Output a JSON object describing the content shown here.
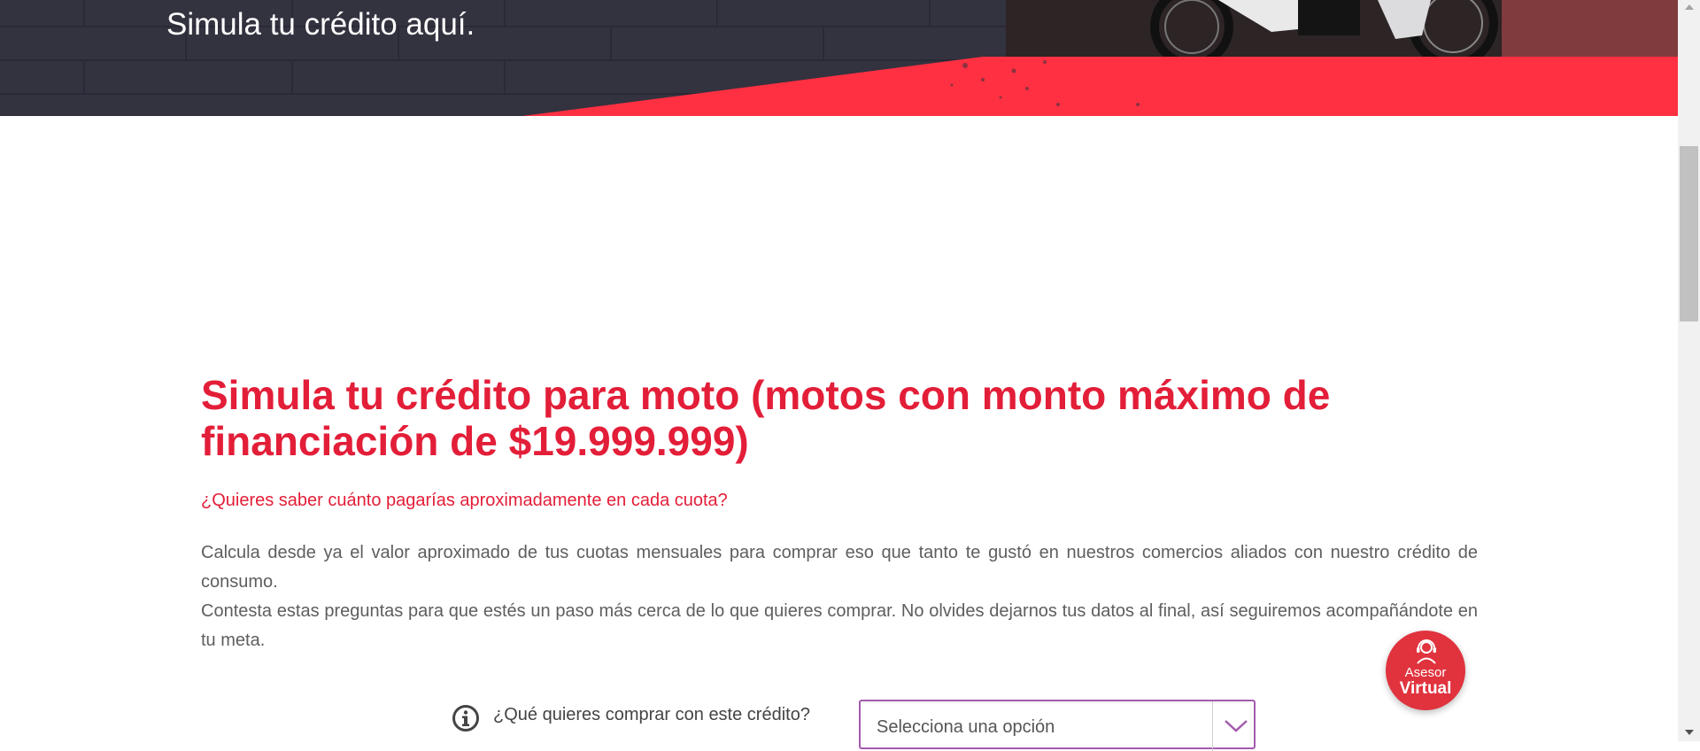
{
  "hero": {
    "title": "Simula tu crédito aquí."
  },
  "main": {
    "title": "Simula tu crédito para moto (motos con monto máximo de financiación de $19.999.999)",
    "subtitle": "¿Quieres saber cuánto pagarías aproximadamente en cada cuota?",
    "paragraph1": "Calcula desde ya el valor aproximado de tus cuotas mensuales para comprar eso que tanto te gustó en nuestros comercios aliados con nuestro crédito de consumo.",
    "paragraph2": "Contesta estas preguntas para que estés un paso más cerca de lo que quieres comprar. No olvides dejarnos tus datos al final, así seguiremos acompañándote en tu meta."
  },
  "form": {
    "question_label": "¿Qué quieres comprar con este crédito?",
    "select_value": "Selecciona una opción",
    "info_icon": "info-circle-icon",
    "dropdown_icon": "chevron-down-icon"
  },
  "asesor": {
    "line1": "Asesor",
    "line2": "Virtual",
    "icon": "headset-agent-icon"
  },
  "colors": {
    "brand_red": "#e31e38",
    "hero_dark": "#33323f",
    "select_border": "#a35bad",
    "body_text": "#5e5e5e",
    "asesor_bg": "#e0333e"
  }
}
